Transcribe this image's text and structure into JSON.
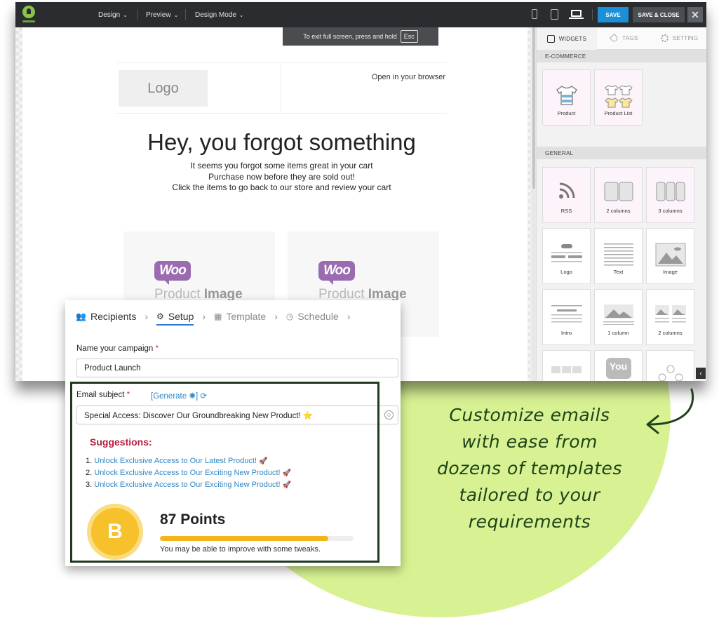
{
  "editor": {
    "menus": [
      "Design",
      "Preview",
      "Design Mode"
    ],
    "save_label": "SAVE",
    "save_close_label": "SAVE & CLOSE",
    "close_label": "✕",
    "esc_tip_text": "To exit full screen, press and hold",
    "esc_key": "Esc",
    "email": {
      "logo_text": "Logo",
      "open_browser": "Open in your browser",
      "headline": "Hey, you forgot something",
      "lines": [
        "It seems you forgot some items great in your cart",
        "Purchase now before they are sold out!",
        "Click the items to go back to our store and review your cart"
      ],
      "product_image_label": "Product",
      "product_image_bold": "Image",
      "woo_text": "Woo"
    },
    "panel": {
      "tabs": [
        "WIDGETS",
        "TAGS",
        "SETTING"
      ],
      "sections": {
        "ecommerce": "E-COMMERCE",
        "general": "GENERAL"
      },
      "ecommerce_tiles": [
        "Product",
        "Product List"
      ],
      "general_tiles": [
        "RSS",
        "2 columns",
        "3 columns",
        "Logo",
        "Text",
        "Image",
        "Intro",
        "1 column",
        "2 columns"
      ]
    }
  },
  "campaign": {
    "steps": [
      "Recipients",
      "Setup",
      "Template",
      "Schedule"
    ],
    "active_step": "Setup",
    "name_label": "Name your campaign",
    "name_value": "Product Launch",
    "subject_label": "Email subject",
    "generate_label": "[Generate",
    "subject_value": "Special Access: Discover Our Groundbreaking New Product! ⭐",
    "suggestions_title": "Suggestions:",
    "suggestions": [
      {
        "num": "1.",
        "text": "Unlock Exclusive Access to Our Latest Product!"
      },
      {
        "num": "2.",
        "text": "Unlock Exclusive Access to Our Exciting New Product!"
      },
      {
        "num": "3.",
        "text": "Unlock Exclusive Access to Our Exciting New Product!"
      }
    ],
    "grade": "B",
    "points": "87 Points",
    "score_fraction": 0.87,
    "improve_text": "You may be able to improve with some tweaks."
  },
  "callout": {
    "lines": [
      "Customize emails",
      "with ease from",
      "dozens of templates",
      "tailored to your",
      "requirements"
    ]
  },
  "colors": {
    "lime": "#d8f293",
    "save_blue": "#1b8fd8",
    "suggest_red": "#b51d3c",
    "link_blue": "#2d86c6",
    "grade_yellow": "#f6c12a",
    "frame_green": "#1f3a1f"
  }
}
